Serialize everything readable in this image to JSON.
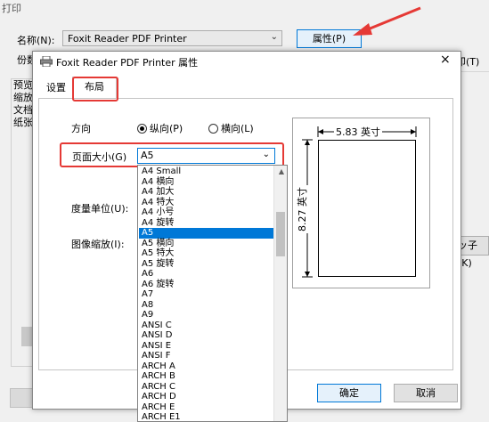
{
  "background_dialog": {
    "title": "打印",
    "name_label": "名称(N):",
    "printer_name": "Foxit Reader PDF Printer",
    "properties_button": "属性(P)",
    "copies_label": "份数",
    "right_text": "印(T)",
    "side_labels": [
      "预览",
      "缩放",
      "文档",
      "纸张"
    ],
    "right_button": "ッ子(K)"
  },
  "properties_dialog": {
    "title": "Foxit Reader PDF Printer 属性",
    "close": "×",
    "tabs": [
      "设置",
      "布局"
    ],
    "active_tab": "布局",
    "orientation_label": "方向",
    "portrait": "纵向(P)",
    "landscape": "横向(L)",
    "paper_size_label": "页面大小(G)",
    "paper_size_value": "A5",
    "units_label": "度量单位(U):",
    "scale_label": "图像缩放(I):",
    "width_label": "5.83 英寸",
    "height_label": "8.27 英寸",
    "ok": "确定",
    "cancel": "取消"
  },
  "dropdown": {
    "items": [
      "A4 Small",
      "A4 横向",
      "A4 加大",
      "A4 特大",
      "A4 小号",
      "A4 旋转",
      "A5",
      "A5 横向",
      "A5 特大",
      "A5 旋转",
      "A6",
      "A6 旋转",
      "A7",
      "A8",
      "A9",
      "ANSI C",
      "ANSI D",
      "ANSI E",
      "ANSI F",
      "ARCH A",
      "ARCH B",
      "ARCH C",
      "ARCH D",
      "ARCH E",
      "ARCH E1"
    ],
    "selected": "A5"
  },
  "colors": {
    "highlight": "#e53935",
    "selection": "#0078d7"
  }
}
